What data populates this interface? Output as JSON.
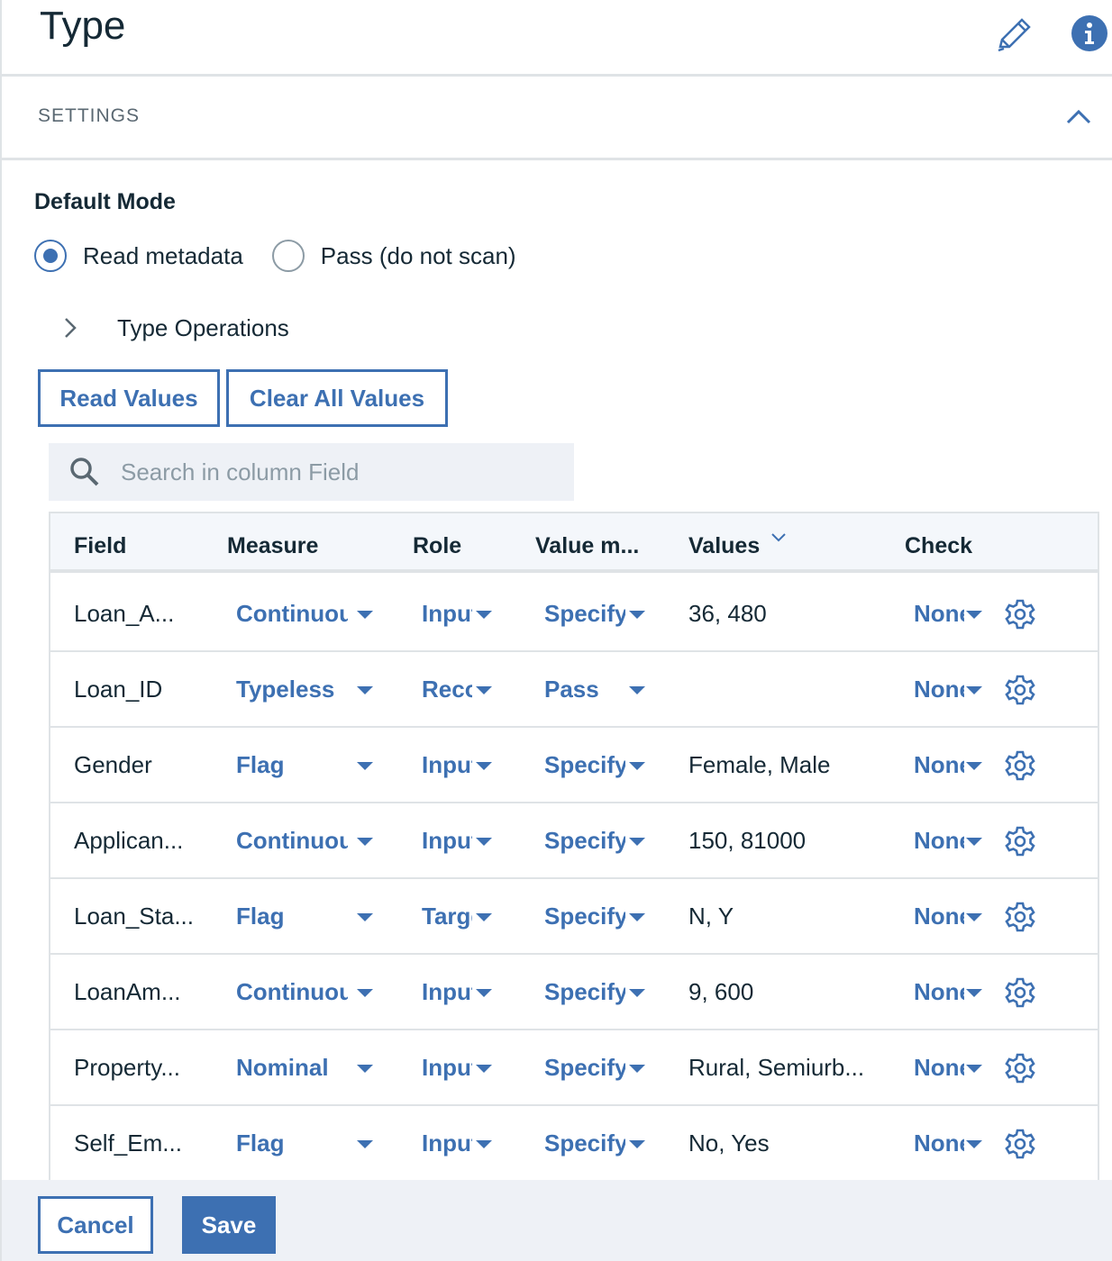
{
  "header": {
    "title": "Type"
  },
  "settings": {
    "label": "SETTINGS"
  },
  "default_mode": {
    "heading": "Default Mode",
    "options": [
      {
        "label": "Read metadata",
        "selected": true
      },
      {
        "label": "Pass (do not scan)",
        "selected": false
      }
    ]
  },
  "type_operations": {
    "label": "Type Operations"
  },
  "buttons": {
    "read_values": "Read Values",
    "clear_all_values": "Clear All Values",
    "cancel": "Cancel",
    "save": "Save"
  },
  "search": {
    "placeholder": "Search in column Field"
  },
  "table": {
    "columns": [
      "Field",
      "Measure",
      "Role",
      "Value m...",
      "Values",
      "Check"
    ],
    "rows": [
      {
        "field": "Loan_A...",
        "measure": "Continuous",
        "role": "Input",
        "value_mode": "Specify",
        "values": "36, 480",
        "check": "None"
      },
      {
        "field": "Loan_ID",
        "measure": "Typeless",
        "role": "Record ID",
        "value_mode": "Pass",
        "values": "",
        "check": "None"
      },
      {
        "field": "Gender",
        "measure": "Flag",
        "role": "Input",
        "value_mode": "Specify",
        "values": "Female, Male",
        "check": "None"
      },
      {
        "field": "Applican...",
        "measure": "Continuous",
        "role": "Input",
        "value_mode": "Specify",
        "values": "150, 81000",
        "check": "None"
      },
      {
        "field": "Loan_Sta...",
        "measure": "Flag",
        "role": "Target",
        "value_mode": "Specify",
        "values": "N, Y",
        "check": "None"
      },
      {
        "field": "LoanAm...",
        "measure": "Continuous",
        "role": "Input",
        "value_mode": "Specify",
        "values": "9, 600",
        "check": "None"
      },
      {
        "field": "Property...",
        "measure": "Nominal",
        "role": "Input",
        "value_mode": "Specify",
        "values": "Rural, Semiurb...",
        "check": "None"
      },
      {
        "field": "Self_Em...",
        "measure": "Flag",
        "role": "Input",
        "value_mode": "Specify",
        "values": "No, Yes",
        "check": "None"
      }
    ]
  },
  "icons": {
    "edit": "pencil-icon",
    "info": "info-icon",
    "collapse": "chevron-up-icon",
    "expand": "chevron-right-icon",
    "search": "search-icon",
    "sort": "chevron-down-icon",
    "row_settings": "gear-icon"
  },
  "colors": {
    "accent": "#3d70b2",
    "footer_bg": "#eef1f6",
    "header_row_bg": "#f4f7fb"
  }
}
